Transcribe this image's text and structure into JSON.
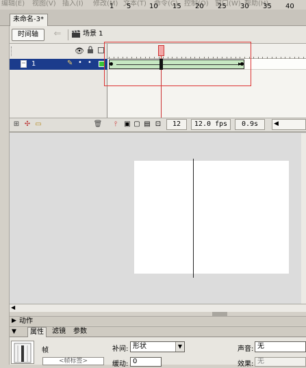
{
  "menu": [
    "编辑(E)",
    "视图(V)",
    "插入(I)",
    "修改(M)",
    "文本(T)",
    "命令(C)",
    "控制(O)",
    "窗口(W)",
    "帮助(H)"
  ],
  "document": {
    "tab_title": "未命名-3*"
  },
  "timeline_header": {
    "timeline_button": "时间轴",
    "scene_label": "场景 1"
  },
  "ruler_labels": [
    "1",
    "5",
    "10",
    "15",
    "20",
    "25",
    "30",
    "35",
    "40"
  ],
  "layer": {
    "name": "1"
  },
  "status": {
    "frame": "12",
    "fps": "12.0 fps",
    "time": "0.9s"
  },
  "panels": {
    "actions": "动作",
    "tabs": [
      "属性",
      "滤镜",
      "参数"
    ]
  },
  "properties": {
    "section_label": "帧",
    "frame_label_placeholder": "<帧标签>",
    "tween_label": "补间:",
    "tween_value": "形状",
    "ease_label": "缓动:",
    "ease_value": "0",
    "sound_label": "声音:",
    "sound_value": "无",
    "effect_label": "效果:",
    "effect_value": "无"
  },
  "colors": {
    "selected_layer": "#1b3c8c",
    "tween_fill": "#c7e7c2",
    "playhead": "#cc3333",
    "annotation": "#dd3333"
  }
}
